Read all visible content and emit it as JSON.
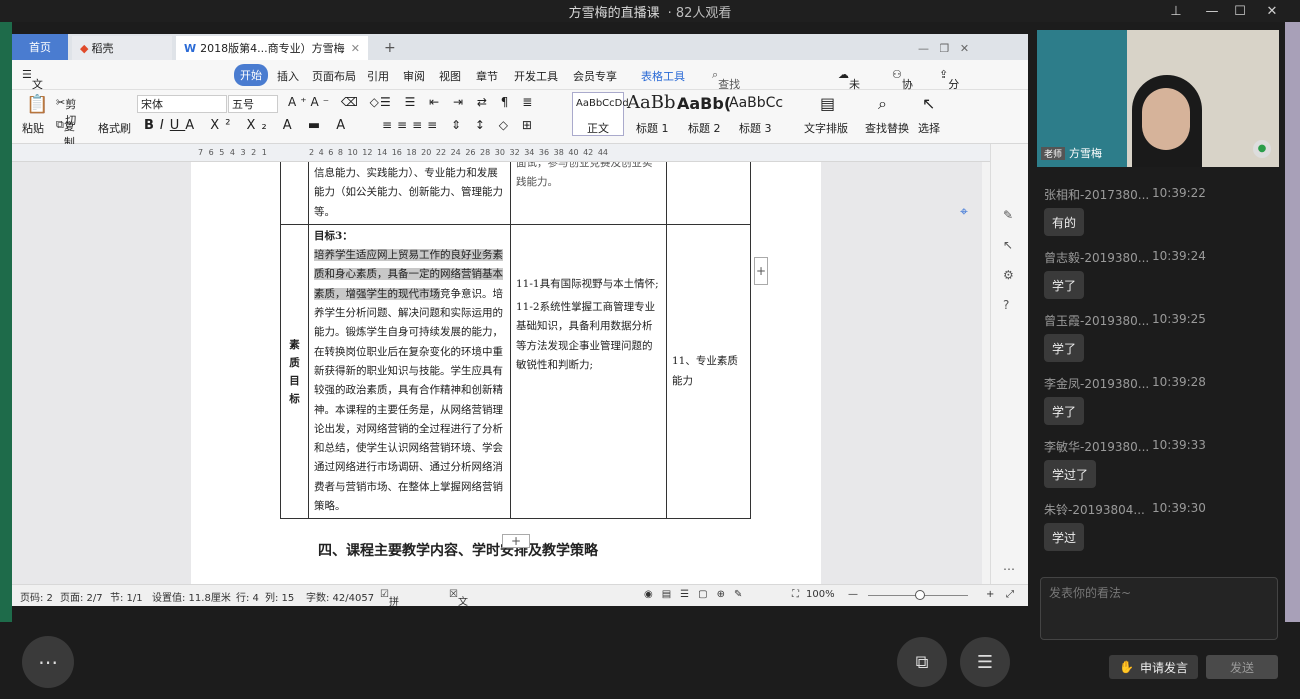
{
  "live": {
    "title": "方雪梅的直播课",
    "viewers": "· 82人观看"
  },
  "tabs": {
    "home": "首页",
    "daoke": "稻壳",
    "doc": "2018版第4...商专业）方雪梅"
  },
  "menu": [
    "文件",
    "开始",
    "插入",
    "页面布局",
    "引用",
    "审阅",
    "视图",
    "章节",
    "开发工具",
    "会员专享",
    "表格工具"
  ],
  "menu_right": {
    "search": "查找命令、搜索模板",
    "sync": "未同步",
    "collab": "协作",
    "share": "分享"
  },
  "ribbon": {
    "paste": "粘贴",
    "cut": "剪切",
    "copy": "复制",
    "format_painter": "格式刷",
    "font": "宋体",
    "size": "五号",
    "styles": [
      {
        "preview": "AaBbCcDd",
        "label": "正文"
      },
      {
        "preview": "AaBb",
        "label": "标题 1"
      },
      {
        "preview": "AaBb(",
        "label": "标题 2"
      },
      {
        "preview": "AaBbCc",
        "label": "标题 3"
      }
    ],
    "text_layout": "文字排版",
    "find_replace": "查找替换",
    "select": "选择"
  },
  "ruler_left": "7 6 5 4 3 2 1",
  "ruler_right": "2 4 6 8 10 12 14 16 18 20 22 24 26 28 30 32 34 36 38 40 42 44",
  "table": {
    "top_cell": "信息能力、实践能力）、专业能力和发展能力（如公关能力、创新能力、管理能力等。",
    "top_col2": "面试，参与创业竞赛及创业实践能力。",
    "side_label": "素质目标",
    "goal_title": "目标3：",
    "goal_highlight": "培养学生适应网上贸易工作的良好业务素质和身心素质，具备一定的网络营销基本素质，增强学生的现代市场",
    "goal_text": "竞争意识。培养学生分析问题、解决问题和实际运用的能力。锻炼学生自身可持续发展的能力，在转换岗位职业后在复杂变化的环境中重新获得新的职业知识与技能。学生应具有较强的政治素质，具有合作精神和创新精神。本课程的主要任务是，从网络营销理论出发，对网络营销的全过程进行了分析和总结，使学生认识网络营销环境、学会通过网络进行市场调研、通过分析网络消费者与营销市场、在整体上掌握网络营销策略。",
    "req1": "11-1具有国际视野与本土情怀;",
    "req2": "11-2系统性掌握工商管理专业基础知识，具备利用数据分析等方法发现企事业管理问题的敏锐性和判断力;",
    "outcome": "11、专业素质能力"
  },
  "heading": "四、课程主要教学内容、学时安排及教学策略",
  "status": {
    "page": "页码: 2",
    "pages": "页面: 2/7",
    "section": "节: 1/1",
    "setting": "设置值: 11.8厘米",
    "row": "行: 4",
    "col": "列: 15",
    "words": "字数: 42/4057",
    "spell": "拼写检查",
    "proof": "文档校对",
    "zoom": "100%"
  },
  "camera": {
    "role": "老师",
    "name": "方雪梅"
  },
  "chat": [
    {
      "name": "张相和-2017380...",
      "time": "10:39:22",
      "msg": "有的"
    },
    {
      "name": "曾志毅-2019380...",
      "time": "10:39:24",
      "msg": "学了"
    },
    {
      "name": "曾玉霞-2019380...",
      "time": "10:39:25",
      "msg": "学了"
    },
    {
      "name": "李金凤-2019380...",
      "time": "10:39:28",
      "msg": "学了"
    },
    {
      "name": "李敏华-2019380...",
      "time": "10:39:33",
      "msg": "学过了"
    },
    {
      "name": "朱铃-20193804...",
      "time": "10:39:30",
      "msg": "学过"
    }
  ],
  "input_placeholder": "发表你的看法~",
  "raise_hand": "申请发言",
  "send": "发送"
}
